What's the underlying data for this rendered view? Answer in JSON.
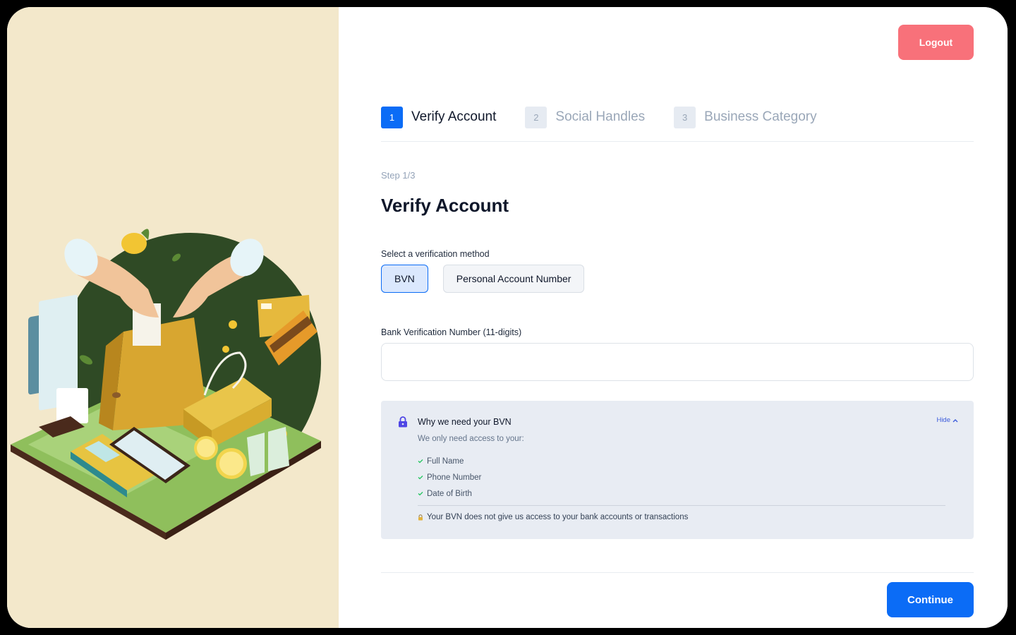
{
  "header": {
    "logout_label": "Logout"
  },
  "stepper": {
    "steps": [
      {
        "number": "1",
        "label": "Verify Account",
        "state": "active"
      },
      {
        "number": "2",
        "label": "Social Handles",
        "state": "inactive"
      },
      {
        "number": "3",
        "label": "Business Category",
        "state": "inactive"
      }
    ]
  },
  "form": {
    "step_count": "Step 1/3",
    "title": "Verify Account",
    "method_label": "Select a verification method",
    "methods": [
      {
        "label": "BVN",
        "selected": true
      },
      {
        "label": "Personal Account Number",
        "selected": false
      }
    ],
    "bvn_label": "Bank Verification Number (11-digits)",
    "bvn_value": ""
  },
  "info": {
    "title": "Why we need your BVN",
    "toggle_label": "Hide",
    "subtitle": "We only need access to your:",
    "items": [
      "Full Name",
      "Phone Number",
      "Date of Birth"
    ],
    "note": "Your BVN does not give us access to your bank accounts or transactions"
  },
  "footer": {
    "continue_label": "Continue"
  },
  "colors": {
    "primary": "#0b6cf6",
    "logout": "#f8717a",
    "left_panel_bg": "#f3e8cb",
    "info_bg": "#e8ecf3",
    "check": "#22c55e",
    "lock": "#4f46e5"
  },
  "icons": [
    "lock-icon",
    "chevron-up-icon",
    "check-icon",
    "padlock-emoji-icon"
  ]
}
